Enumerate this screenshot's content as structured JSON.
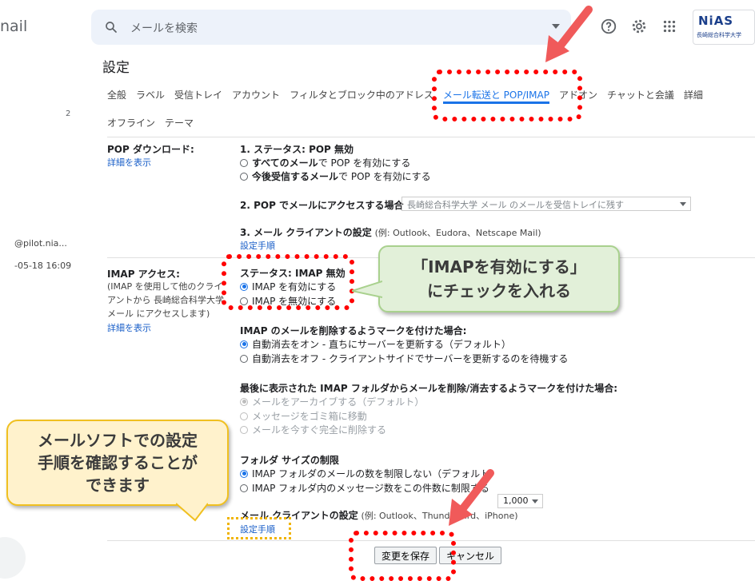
{
  "app": {
    "title": "nail"
  },
  "search": {
    "placeholder": "メールを検索"
  },
  "logo": {
    "mark": "NiAS",
    "sub": "長崎総合科学大学"
  },
  "settings_title": "設定",
  "tabs": [
    {
      "label": "全般"
    },
    {
      "label": "ラベル"
    },
    {
      "label": "受信トレイ"
    },
    {
      "label": "アカウント"
    },
    {
      "label": "フィルタとブロック中のアドレス"
    },
    {
      "label": "メール転送と POP/IMAP"
    },
    {
      "label": "アドオン"
    },
    {
      "label": "チャットと会議"
    },
    {
      "label": "詳細"
    }
  ],
  "tabs2": [
    {
      "label": "オフライン"
    },
    {
      "label": "テーマ"
    }
  ],
  "left": {
    "count": "2",
    "mail": "@pilot.nia...",
    "date": "-05-18 16:09"
  },
  "pop": {
    "label": "POP ダウンロード:",
    "detail": "詳細を表示",
    "status": "1. ステータス: POP 無効",
    "opt1a": "すべてのメール",
    "opt1b": "で POP を有効にする",
    "opt2a": "今後受信するメール",
    "opt2b": "で POP を有効にする",
    "access_label": "2. POP でメールにアクセスする場合",
    "access_value": "長崎総合科学大学 メール のメールを受信トレイに残す",
    "client_label": "3. メール クライアントの設定",
    "client_example": "(例: Outlook、Eudora、Netscape Mail)",
    "client_link": "設定手順"
  },
  "imap": {
    "label": "IMAP アクセス:",
    "desc": "(IMAP を使用して他のクライアントから 長崎総合科学大学 メール にアクセスします)",
    "detail": "詳細を表示",
    "status": "ステータス: IMAP 無効",
    "enable": "IMAP を有効にする",
    "disable": "IMAP を無効にする",
    "delete_heading": "IMAP のメールを削除するようマークを付けた場合:",
    "del1": "自動消去をオン - 直ちにサーバーを更新する（デフォルト）",
    "del2": "自動消去をオフ - クライアントサイドでサーバーを更新するのを待機する",
    "expunge_heading": "最後に表示された IMAP フォルダからメールを削除/消去するようマークを付けた場合:",
    "exp1": "メールをアーカイブする（デフォルト）",
    "exp2": "メッセージをゴミ箱に移動",
    "exp3": "メールを今すぐ完全に削除する",
    "folder_heading": "フォルダ サイズの制限",
    "f1": "IMAP フォルダのメールの数を制限しない（デフォルト）",
    "f2": "IMAP フォルダ内のメッセージ数をこの件数に制限する",
    "f2_value": "1,000",
    "client_label": "メール クライアントの設定",
    "client_example": "(例: Outlook、Thunderbird、iPhone)",
    "client_link": "設定手順"
  },
  "buttons": {
    "save": "変更を保存",
    "cancel": "キャンセル"
  },
  "callouts": {
    "green_line1": "「IMAPを有効にする」",
    "green_line2": "にチェックを入れる",
    "yellow_line1": "メールソフトでの設定",
    "yellow_line2": "手順を確認することが",
    "yellow_line3": "できます"
  },
  "colors": {
    "accent": "#1a73e8",
    "annotation_red": "#ff0000",
    "annotation_yellow": "#f0b400",
    "arrow": "#f05a5a"
  }
}
